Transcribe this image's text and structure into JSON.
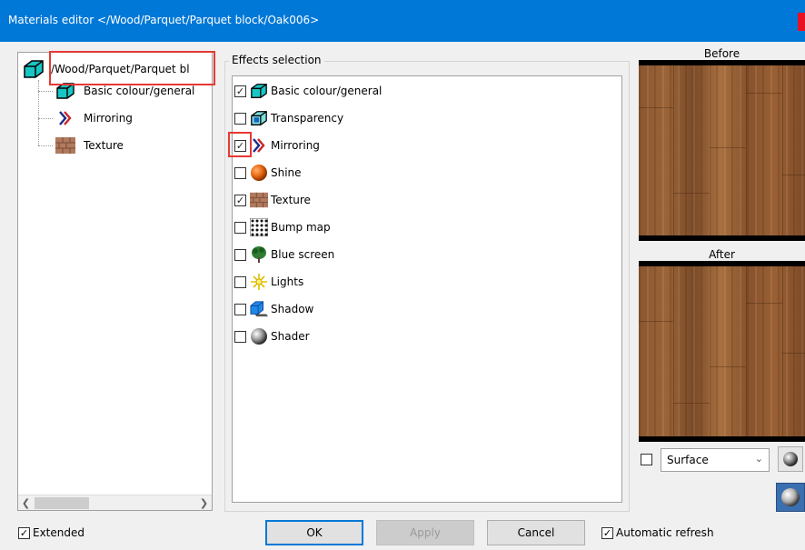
{
  "window": {
    "title": "Materials editor  </Wood/Parquet/Parquet block/Oak006>"
  },
  "tree": {
    "root_label": "/Wood/Parquet/Parquet bl",
    "items": [
      {
        "label": "Basic colour/general",
        "icon": "cube-icon"
      },
      {
        "label": "Mirroring",
        "icon": "mirroring-icon"
      },
      {
        "label": "Texture",
        "icon": "brick-texture-icon"
      }
    ]
  },
  "effects": {
    "group_label": "Effects selection",
    "items": [
      {
        "label": "Basic colour/general",
        "checked": true,
        "icon": "cube-icon"
      },
      {
        "label": "Transparency",
        "checked": false,
        "icon": "transparency-cube-icon"
      },
      {
        "label": "Mirroring",
        "checked": true,
        "icon": "mirroring-icon"
      },
      {
        "label": "Shine",
        "checked": false,
        "icon": "orange-sphere-icon"
      },
      {
        "label": "Texture",
        "checked": true,
        "icon": "brick-texture-icon"
      },
      {
        "label": "Bump map",
        "checked": false,
        "icon": "bump-map-grid-icon"
      },
      {
        "label": "Blue screen",
        "checked": false,
        "icon": "tree-icon"
      },
      {
        "label": "Lights",
        "checked": false,
        "icon": "light-burst-icon"
      },
      {
        "label": "Shadow",
        "checked": false,
        "icon": "shadow-cube-icon"
      },
      {
        "label": "Shader",
        "checked": false,
        "icon": "grey-sphere-icon"
      }
    ]
  },
  "preview": {
    "before_label": "Before",
    "after_label": "After"
  },
  "surface": {
    "checked": false,
    "selected": "Surface"
  },
  "bottom": {
    "extended_label": "Extended",
    "extended_checked": true,
    "ok_label": "OK",
    "apply_label": "Apply",
    "cancel_label": "Cancel",
    "auto_refresh_label": "Automatic refresh",
    "auto_refresh_checked": true
  },
  "colors": {
    "title_bar": "#0078d7",
    "highlight": "#e53935"
  }
}
